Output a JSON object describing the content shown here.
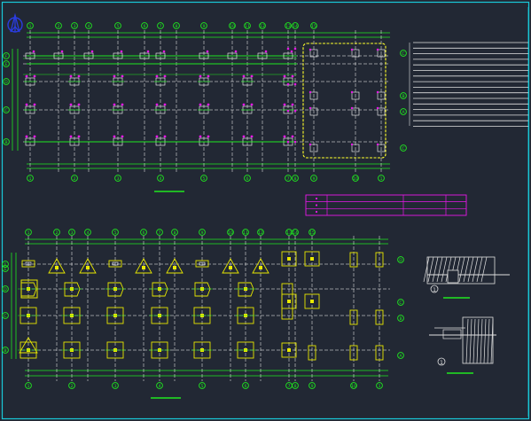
{
  "colors": {
    "background": "#222834",
    "frame": "#19c8d8",
    "axis": "#1fe81f",
    "column": "#ffffff",
    "rebar": "#e818e8",
    "highlight": "#ffff2a",
    "pad": "#e8e800",
    "bubble_text": "#1fe81f",
    "north": "#2a3ce0"
  },
  "north_arrow": {
    "icon": "north-arrow-icon"
  },
  "top_plan": {
    "axis_labels_top": [
      "1",
      "2",
      "3",
      "4",
      "5",
      "6",
      "7",
      "8",
      "9",
      "10",
      "11",
      "12",
      "13",
      "14",
      "15"
    ],
    "axis_labels_bottom": [
      "1",
      "2",
      "3",
      "4",
      "5",
      "6",
      "7",
      "8",
      "9",
      "10"
    ],
    "row_labels_left": [
      "F",
      "E",
      "D",
      "C",
      "B",
      "A"
    ],
    "row_labels_right": [
      "C",
      "B",
      "A"
    ]
  },
  "bottom_plan": {
    "axis_labels_top": [
      "1",
      "2",
      "3",
      "4",
      "5",
      "6",
      "7",
      "8",
      "9",
      "10",
      "11",
      "12",
      "13",
      "14",
      "15"
    ],
    "axis_labels_bottom": [
      "1",
      "2",
      "3",
      "4",
      "5",
      "6",
      "7",
      "8",
      "9",
      "10"
    ],
    "row_labels_left": [
      "F",
      "E",
      "D",
      "C",
      "B",
      "A"
    ],
    "row_labels_right": [
      "D",
      "C",
      "B",
      "A"
    ]
  },
  "table": {
    "rows": 3,
    "cols": 4
  },
  "details": [
    {
      "label": "1"
    },
    {
      "label": "1"
    }
  ]
}
